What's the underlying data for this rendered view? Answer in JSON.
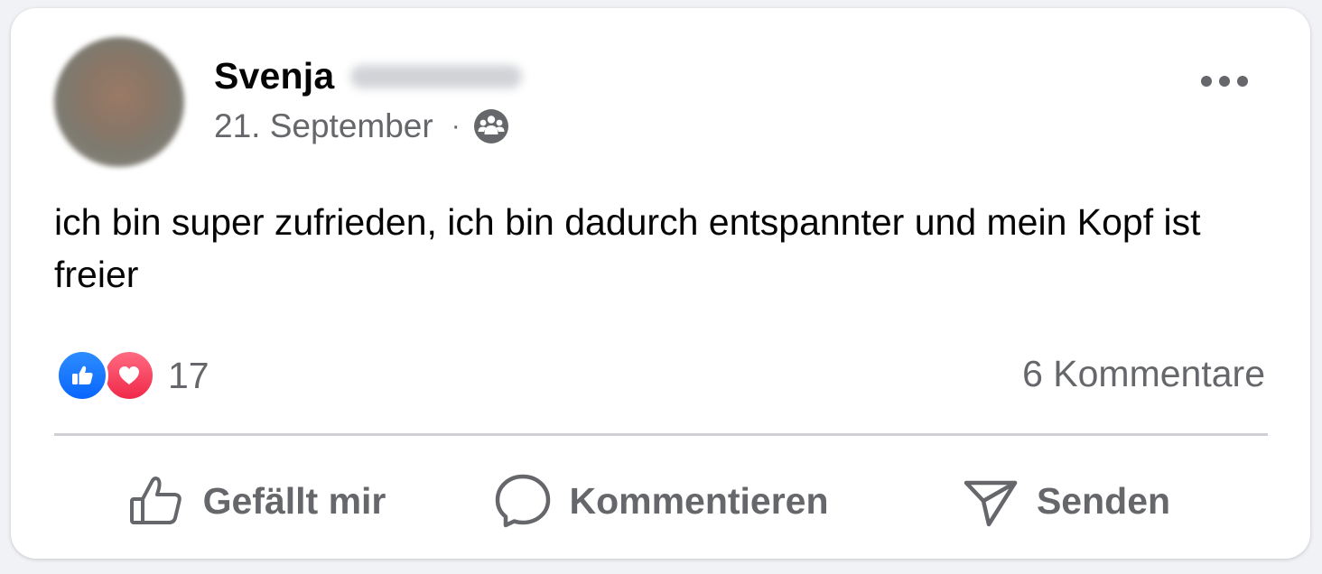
{
  "post": {
    "author_name": "Svenja",
    "date": "21. September",
    "separator": "·",
    "audience_icon": "friends-group-icon",
    "text": "ich bin super zufrieden, ich bin dadurch entspannter und mein Kopf ist freier"
  },
  "reactions": {
    "types": [
      "like",
      "love"
    ],
    "count": "17",
    "comments_label": "6 Kommentare"
  },
  "actions": {
    "like_label": "Gefällt mir",
    "comment_label": "Kommentieren",
    "send_label": "Senden"
  },
  "colors": {
    "card_bg": "#ffffff",
    "text_primary": "#050505",
    "text_secondary": "#65676b",
    "like_blue": "#0866ff",
    "love_red": "#f02849",
    "divider": "#ced0d4"
  }
}
